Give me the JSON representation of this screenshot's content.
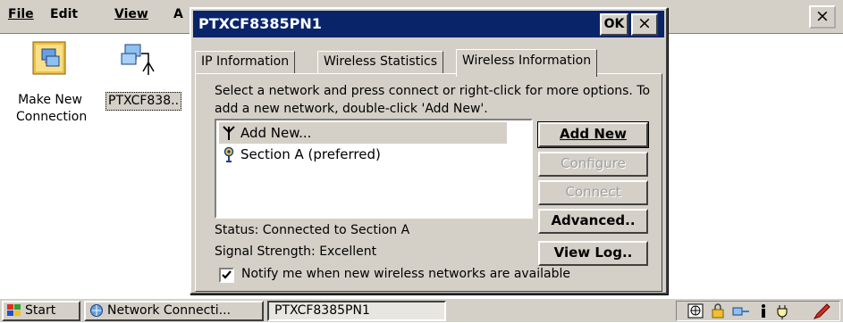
{
  "explorer": {
    "menu": {
      "file": "File",
      "edit": "Edit",
      "view": "View",
      "advanced_clipped": "A"
    },
    "close_label": "×",
    "items": [
      {
        "label_line1": "Make New",
        "label_line2": "Connection",
        "icon": "make-new-connection-icon"
      },
      {
        "label": "PTXCF838..",
        "icon": "network-connection-icon"
      }
    ]
  },
  "dialog": {
    "title": "PTXCF8385PN1",
    "ok_label": "OK",
    "close_label": "×",
    "tabs": [
      {
        "label": "IP Information",
        "active": false
      },
      {
        "label": "Wireless Statistics",
        "active": false
      },
      {
        "label": "Wireless Information",
        "active": true
      }
    ],
    "instructions": "Select a network and press connect or right-click for more options.  To add a new network, double-click 'Add New'.",
    "networks": [
      {
        "label": "Add New...",
        "icon": "antenna-icon",
        "selected": true
      },
      {
        "label": "Section A (preferred)",
        "icon": "wireless-network-icon",
        "selected": false
      }
    ],
    "buttons": {
      "add_new": "Add New",
      "configure": "Configure",
      "connect": "Connect",
      "advanced": "Advanced..",
      "view_log": "View Log.."
    },
    "status_label": "Status:",
    "status_value": "Connected to Section A",
    "signal_label": "Signal Strength:",
    "signal_value": "Excellent",
    "notify_checked": true,
    "notify_label": "Notify me when new wireless networks are available"
  },
  "taskbar": {
    "start_label": "Start",
    "tasks": [
      {
        "label": "Network Connecti...",
        "active": false
      },
      {
        "label": "PTXCF8385PN1",
        "active": true
      }
    ],
    "tray_icons": [
      "keyboard-icon",
      "lock-icon",
      "network-tray-icon",
      "info-icon",
      "power-plug-icon",
      "pen-icon"
    ]
  },
  "colors": {
    "title_bar": "#0a246a",
    "face": "#d4d0c8",
    "desktop": "#ffffff"
  }
}
